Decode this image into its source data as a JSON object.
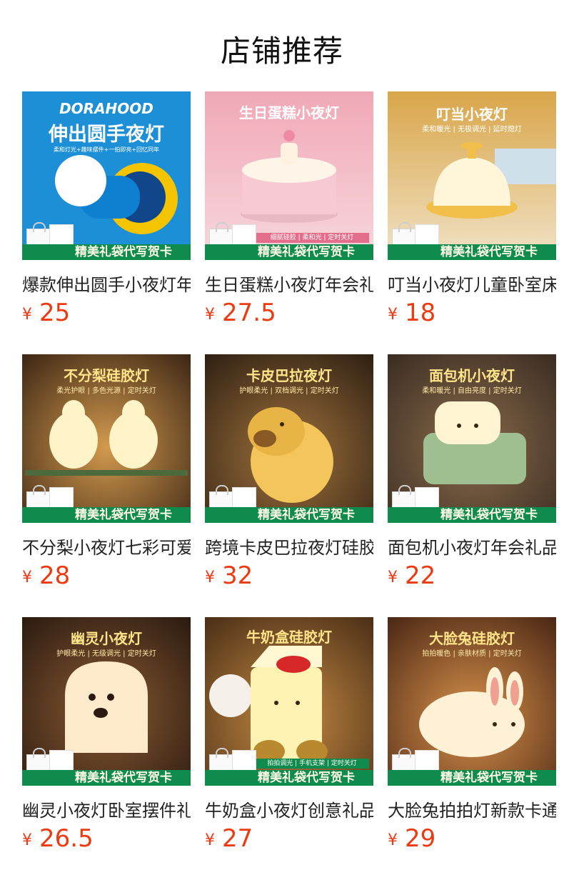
{
  "shop": {
    "title": "店铺推荐"
  },
  "products": [
    {
      "name": "爆款伸出圆手小夜灯年会礼品",
      "currency": "¥",
      "price": "25",
      "banner": {
        "brand": "DORAHOOD",
        "title": "伸出圆手夜灯",
        "sub": "柔和灯光+趣味摆件+一拍即亮+回忆同年",
        "ribbon": "精美礼袋代写贺卡"
      }
    },
    {
      "name": "生日蛋糕小夜灯年会礼品",
      "currency": "¥",
      "price": "27.5",
      "banner": {
        "title": "生日蛋糕小夜灯",
        "sub": "细腻硅胶 | 柔和光 | 定时关灯",
        "ribbon": "精美礼袋代写贺卡"
      }
    },
    {
      "name": "叮当小夜灯儿童卧室床头灯",
      "currency": "¥",
      "price": "18",
      "banner": {
        "title": "叮当小夜灯",
        "sub": "柔和暖光 | 无极调光 | 延时熄灯",
        "ribbon": "精美礼袋代写贺卡"
      }
    },
    {
      "name": "不分梨小夜灯七彩可爱礼物",
      "currency": "¥",
      "price": "28",
      "banner": {
        "title": "不分梨硅胶灯",
        "sub": "柔光护眼 | 多色光源 | 定时关灯",
        "ribbon": "精美礼袋代写贺卡"
      }
    },
    {
      "name": "跨境卡皮巴拉夜灯硅胶拍拍灯",
      "currency": "¥",
      "price": "32",
      "banner": {
        "title": "卡皮巴拉夜灯",
        "sub": "护眼柔光 | 双档调光 | 定时关灯",
        "ribbon": "精美礼袋代写贺卡"
      }
    },
    {
      "name": "面包机小夜灯年会礼品",
      "currency": "¥",
      "price": "22",
      "banner": {
        "title": "面包机小夜灯",
        "sub": "柔和暖光 | 自由亮度 | 定时关灯",
        "ribbon": "精美礼袋代写贺卡"
      }
    },
    {
      "name": "幽灵小夜灯卧室摆件礼品",
      "currency": "¥",
      "price": "26.5",
      "banner": {
        "title": "幽灵小夜灯",
        "sub": "护眼柔光 | 无级调光 | 定时关灯",
        "ribbon": "精美礼袋代写贺卡"
      }
    },
    {
      "name": "牛奶盒小夜灯创意礼品",
      "currency": "¥",
      "price": "27",
      "banner": {
        "title": "牛奶盒硅胶灯",
        "sub": "拍拍调光 | 手机支架 | 定时关灯",
        "ribbon": "精美礼袋代写贺卡"
      }
    },
    {
      "name": "大脸兔拍拍灯新款卡通礼物",
      "currency": "¥",
      "price": "29",
      "banner": {
        "title": "大脸兔硅胶灯",
        "sub": "拍拍暖色 | 亲肤材质 | 定时关灯",
        "ribbon": "精美礼袋代写贺卡"
      }
    }
  ]
}
